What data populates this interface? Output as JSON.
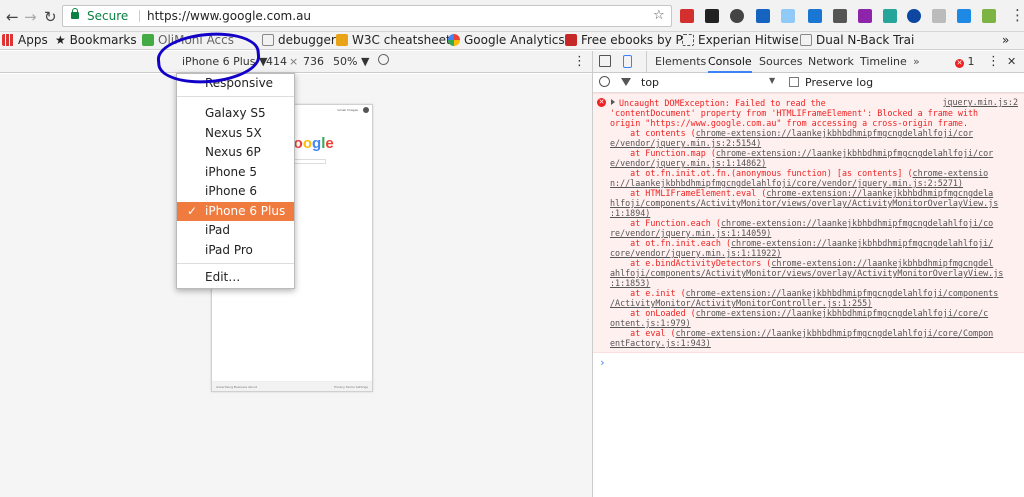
{
  "browser": {
    "back_glyph": "←",
    "forward_glyph": "→",
    "reload_glyph": "↻",
    "secure_label": "Secure",
    "url": "https://www.google.com.au",
    "star_glyph": "☆",
    "menu_glyph": "⋮"
  },
  "bookmarks": {
    "apps_label": "Apps",
    "bookmarks_label": "Bookmarks",
    "item_olib": "OliMoni Accs",
    "item_debugger": "debugger",
    "item_w3c": "W3C cheatsheet",
    "item_ga": "Google Analytics",
    "item_ebooks": "Free ebooks by P",
    "item_experian": "Experian Hitwise",
    "item_nback": "Dual N-Back Trai",
    "overflow": "»"
  },
  "device_toolbar": {
    "device_label": "iPhone 6 Plus",
    "caret": "▼",
    "width": "414",
    "times": "×",
    "height": "736",
    "zoom": "50%",
    "zoom_caret": "▼",
    "rotate_glyph": "⃠",
    "more_glyph": "⋮"
  },
  "device_menu": {
    "responsive": "Responsive",
    "items": [
      "Galaxy S5",
      "Nexus 5X",
      "Nexus 6P",
      "iPhone 5",
      "iPhone 6",
      "iPhone 6 Plus",
      "iPad",
      "iPad Pro"
    ],
    "selected_index": 5,
    "check": "✓",
    "edit": "Edit…"
  },
  "page_preview": {
    "logo": "Google",
    "top_links": "Gmail Images",
    "footer_left": "Advertising  Business  About",
    "footer_right": "Privacy  Terms  Settings"
  },
  "devtools": {
    "tabs": [
      "Elements",
      "Console",
      "Sources",
      "Network",
      "Timeline"
    ],
    "active_tab": "Console",
    "error_count": "1",
    "more_glyph": "⋮",
    "close_glyph": "✕",
    "context": "top",
    "preserve_log": "Preserve log"
  },
  "console": {
    "error_source": "jquery.min.js:2",
    "lines": [
      {
        "t": "Uncaught DOMException: Failed to read the",
        "l": ""
      },
      {
        "t": "'contentDocument' property from 'HTMLIFrameElement': Blocked a frame with",
        "l": ""
      },
      {
        "t": "origin \"https://www.google.com.au\" from accessing a cross-origin frame.",
        "l": ""
      },
      {
        "t": "    at contents (",
        "l": "chrome-extension://laankejkbhbdhmipfmgcngdelahlfoji/cor"
      },
      {
        "t": "",
        "l": "e/vendor/jquery.min.js:2:5154)"
      },
      {
        "t": "    at Function.map (",
        "l": "chrome-extension://laankejkbhbdhmipfmgcngdelahlfoji/cor"
      },
      {
        "t": "",
        "l": "e/vendor/jquery.min.js:1:14862)"
      },
      {
        "t": "    at ot.fn.init.ot.fn.(anonymous function) [as contents] (",
        "l": "chrome-extensio"
      },
      {
        "t": "",
        "l": "n://laankejkbhbdhmipfmgcngdelahlfoji/core/vendor/jquery.min.js:2:5271)"
      },
      {
        "t": "    at HTMLIFrameElement.eval (",
        "l": "chrome-extension://laankejkbhbdhmipfmgcngdela"
      },
      {
        "t": "",
        "l": "hlfoji/components/ActivityMonitor/views/overlay/ActivityMonitorOverlayView.js"
      },
      {
        "t": "",
        "l": ":1:1894)"
      },
      {
        "t": "    at Function.each (",
        "l": "chrome-extension://laankejkbhbdhmipfmgcngdelahlfoji/co"
      },
      {
        "t": "",
        "l": "re/vendor/jquery.min.js:1:14059)"
      },
      {
        "t": "    at ot.fn.init.each (",
        "l": "chrome-extension://laankejkbhbdhmipfmgcngdelahlfoji/"
      },
      {
        "t": "",
        "l": "core/vendor/jquery.min.js:1:11922)"
      },
      {
        "t": "    at e.bindActivityDetectors (",
        "l": "chrome-extension://laankejkbhbdhmipfmgcngdel"
      },
      {
        "t": "",
        "l": "ahlfoji/components/ActivityMonitor/views/overlay/ActivityMonitorOverlayView.js"
      },
      {
        "t": "",
        "l": ":1:1853)"
      },
      {
        "t": "    at e.init (",
        "l": "chrome-extension://laankejkbhbdhmipfmgcngdelahlfoji/components"
      },
      {
        "t": "",
        "l": "/ActivityMonitor/ActivityMonitorController.js:1:255)"
      },
      {
        "t": "    at onLoaded (",
        "l": "chrome-extension://laankejkbhbdhmipfmgcngdelahlfoji/core/c"
      },
      {
        "t": "",
        "l": "ontent.js:1:979)"
      },
      {
        "t": "    at eval (",
        "l": "chrome-extension://laankejkbhbdhmipfmgcngdelahlfoji/core/Compon"
      },
      {
        "t": "",
        "l": "entFactory.js:1:943)"
      }
    ],
    "prompt": "›"
  },
  "colors": {
    "accent": "#f07b3f",
    "error": "#e22222",
    "annotation": "#1200c8"
  }
}
